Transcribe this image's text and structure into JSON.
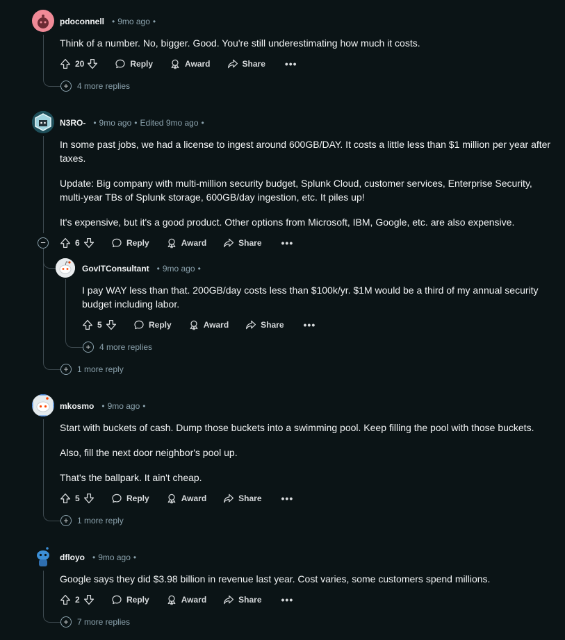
{
  "comments": [
    {
      "user": "pdoconnell",
      "meta": [
        "9mo ago"
      ],
      "body": [
        "Think of a number. No, bigger. Good. You're still underestimating how much it costs."
      ],
      "votes": "20",
      "more": "4 more replies"
    },
    {
      "user": "N3RO-",
      "meta": [
        "9mo ago",
        "Edited 9mo ago"
      ],
      "body": [
        "In some past jobs, we had a license to ingest around 600GB/DAY. It costs a little less than $1 million per year after taxes.",
        "Update: Big company with multi-million security budget, Splunk Cloud, customer services, Enterprise Security, multi-year TBs of Splunk storage, 600GB/day ingestion, etc. It piles up!",
        "It's expensive, but it's a good product. Other options from Microsoft, IBM, Google, etc. are also expensive."
      ],
      "votes": "6",
      "more": "1 more reply",
      "reply": {
        "user": "GovITConsultant",
        "meta": [
          "9mo ago"
        ],
        "body": [
          "I pay WAY less than that. 200GB/day costs less than $100k/yr. $1M would be a third of my annual security budget including labor."
        ],
        "votes": "5",
        "more": "4 more replies"
      }
    },
    {
      "user": "mkosmo",
      "meta": [
        "9mo ago"
      ],
      "body": [
        "Start with buckets of cash. Dump those buckets into a swimming pool. Keep filling the pool with those buckets.",
        "Also, fill the next door neighbor's pool up.",
        "That's the ballpark. It ain't cheap."
      ],
      "votes": "5",
      "more": "1 more reply"
    },
    {
      "user": "dfloyo",
      "meta": [
        "9mo ago"
      ],
      "body": [
        "Google says they did $3.98 billion in revenue last year. Cost varies, some customers spend millions."
      ],
      "votes": "2",
      "more": "7 more replies"
    }
  ],
  "labels": {
    "reply": "Reply",
    "award": "Award",
    "share": "Share",
    "overflow": "•••"
  },
  "icons": [
    "upvote-icon",
    "downvote-icon",
    "reply-icon",
    "award-icon",
    "share-icon",
    "overflow-icon",
    "expand-icon",
    "collapse-icon"
  ],
  "colors": {
    "background": "#0b1416",
    "text": "#f2f4f5",
    "muted": "#8ba2ad",
    "thread": "#3e4a50",
    "avatar_pink": "#f08a97"
  }
}
